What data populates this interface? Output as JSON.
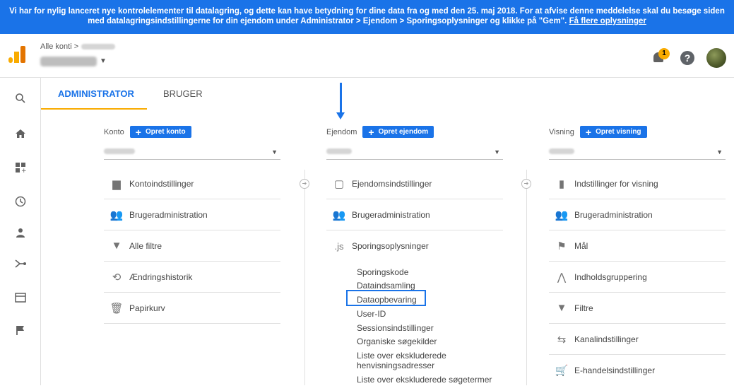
{
  "banner": {
    "text": "Vi har for nylig lanceret nye kontrolelementer til datalagring, og dette kan have betydning for dine data fra og med den 25. maj 2018. For at afvise denne meddelelse skal du besøge siden med datalagringsindstillingerne for din ejendom under Administrator > Ejendom > Sporingsoplysninger og klikke på \"Gem\".",
    "link": "Få flere oplysninger"
  },
  "header": {
    "breadcrumb": "Alle konti >",
    "notification_count": "1",
    "help": "?"
  },
  "tabs": {
    "admin": "ADMINISTRATOR",
    "user": "BRUGER"
  },
  "account": {
    "label": "Konto",
    "add": "Opret konto",
    "items": [
      "Kontoindstillinger",
      "Brugeradministration",
      "Alle filtre",
      "Ændringshistorik",
      "Papirkurv"
    ]
  },
  "property": {
    "label": "Ejendom",
    "add": "Opret ejendom",
    "items": [
      "Ejendomsindstillinger",
      "Brugeradministration",
      "Sporingsoplysninger"
    ],
    "subitems": [
      "Sporingskode",
      "Dataindsamling",
      "Dataopbevaring",
      "User-ID",
      "Sessionsindstillinger",
      "Organiske søgekilder",
      "Liste over ekskluderede henvisningsadresser",
      "Liste over ekskluderede søgetermer"
    ]
  },
  "view": {
    "label": "Visning",
    "add": "Opret visning",
    "items": [
      "Indstillinger for visning",
      "Brugeradministration",
      "Mål",
      "Indholdsgruppering",
      "Filtre",
      "Kanalindstillinger",
      "E-handelsindstillinger"
    ]
  },
  "colors": {
    "accent": "#1a73e8",
    "brand": "#f9ab00"
  }
}
